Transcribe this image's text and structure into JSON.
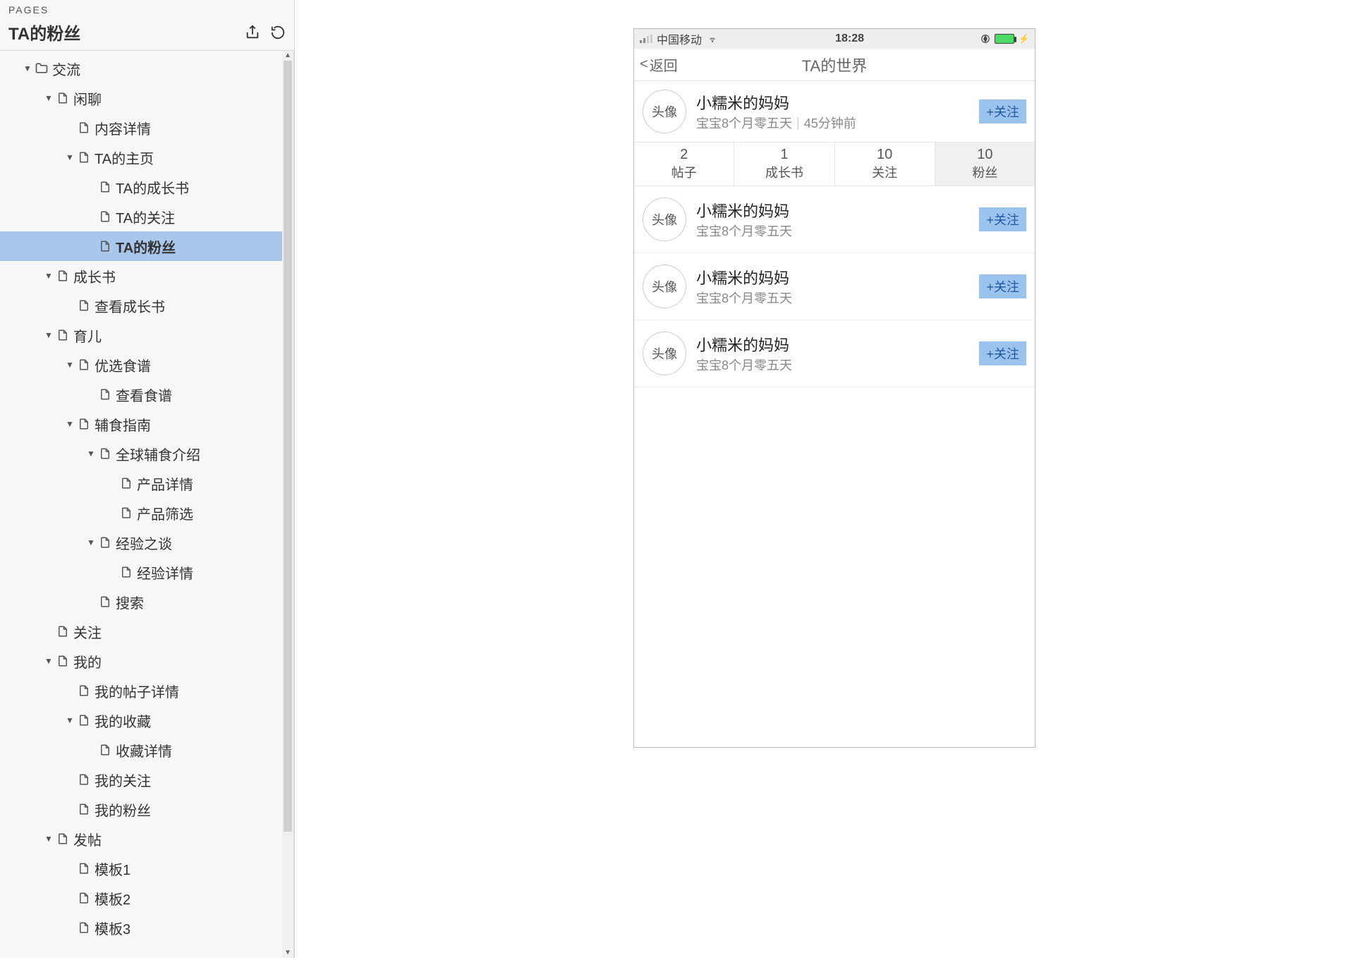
{
  "sidebar": {
    "header": "PAGES",
    "title": "TA的粉丝",
    "items": [
      {
        "indent": 0,
        "caret": "down",
        "kind": "folder",
        "label": "交流"
      },
      {
        "indent": 1,
        "caret": "down",
        "kind": "page",
        "label": "闲聊"
      },
      {
        "indent": 2,
        "caret": "none",
        "kind": "page",
        "label": "内容详情"
      },
      {
        "indent": 2,
        "caret": "down",
        "kind": "page",
        "label": "TA的主页"
      },
      {
        "indent": 3,
        "caret": "none",
        "kind": "page",
        "label": "TA的成长书"
      },
      {
        "indent": 3,
        "caret": "none",
        "kind": "page",
        "label": "TA的关注"
      },
      {
        "indent": 3,
        "caret": "none",
        "kind": "page",
        "label": "TA的粉丝",
        "selected": true
      },
      {
        "indent": 1,
        "caret": "down",
        "kind": "page",
        "label": "成长书"
      },
      {
        "indent": 2,
        "caret": "none",
        "kind": "page",
        "label": "查看成长书"
      },
      {
        "indent": 1,
        "caret": "down",
        "kind": "page",
        "label": "育儿"
      },
      {
        "indent": 2,
        "caret": "down",
        "kind": "page",
        "label": "优选食谱"
      },
      {
        "indent": 3,
        "caret": "none",
        "kind": "page",
        "label": "查看食谱"
      },
      {
        "indent": 2,
        "caret": "down",
        "kind": "page",
        "label": "辅食指南"
      },
      {
        "indent": 3,
        "caret": "down",
        "kind": "page",
        "label": "全球辅食介绍"
      },
      {
        "indent": 4,
        "caret": "none",
        "kind": "page",
        "label": "产品详情"
      },
      {
        "indent": 4,
        "caret": "none",
        "kind": "page",
        "label": "产品筛选"
      },
      {
        "indent": 3,
        "caret": "down",
        "kind": "page",
        "label": "经验之谈"
      },
      {
        "indent": 4,
        "caret": "none",
        "kind": "page",
        "label": "经验详情"
      },
      {
        "indent": 3,
        "caret": "none",
        "kind": "page",
        "label": "搜索"
      },
      {
        "indent": 1,
        "caret": "none",
        "kind": "page",
        "label": "关注"
      },
      {
        "indent": 1,
        "caret": "down",
        "kind": "page",
        "label": "我的"
      },
      {
        "indent": 2,
        "caret": "none",
        "kind": "page",
        "label": "我的帖子详情"
      },
      {
        "indent": 2,
        "caret": "down",
        "kind": "page",
        "label": "我的收藏"
      },
      {
        "indent": 3,
        "caret": "none",
        "kind": "page",
        "label": "收藏详情"
      },
      {
        "indent": 2,
        "caret": "none",
        "kind": "page",
        "label": "我的关注"
      },
      {
        "indent": 2,
        "caret": "none",
        "kind": "page",
        "label": "我的粉丝"
      },
      {
        "indent": 1,
        "caret": "down",
        "kind": "page",
        "label": "发帖"
      },
      {
        "indent": 2,
        "caret": "none",
        "kind": "page",
        "label": "模板1"
      },
      {
        "indent": 2,
        "caret": "none",
        "kind": "page",
        "label": "模板2"
      },
      {
        "indent": 2,
        "caret": "none",
        "kind": "page",
        "label": "模板3"
      }
    ]
  },
  "phone": {
    "status": {
      "carrier": "中国移动",
      "time": "18:28"
    },
    "nav": {
      "back": "返回",
      "title": "TA的世界",
      "back_sym": "<"
    },
    "profile": {
      "avatar": "头像",
      "name": "小糯米的妈妈",
      "sub": "宝宝8个月零五天",
      "time": "45分钟前",
      "follow": "+关注"
    },
    "stats": [
      {
        "num": "2",
        "lab": "帖子"
      },
      {
        "num": "1",
        "lab": "成长书"
      },
      {
        "num": "10",
        "lab": "关注"
      },
      {
        "num": "10",
        "lab": "粉丝",
        "active": true
      }
    ],
    "fans": [
      {
        "avatar": "头像",
        "name": "小糯米的妈妈",
        "sub": "宝宝8个月零五天",
        "follow": "+关注"
      },
      {
        "avatar": "头像",
        "name": "小糯米的妈妈",
        "sub": "宝宝8个月零五天",
        "follow": "+关注"
      },
      {
        "avatar": "头像",
        "name": "小糯米的妈妈",
        "sub": "宝宝8个月零五天",
        "follow": "+关注"
      }
    ]
  }
}
